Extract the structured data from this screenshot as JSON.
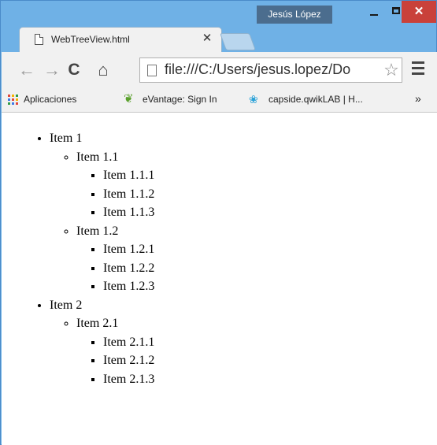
{
  "window": {
    "user_name": "Jesús López",
    "close_glyph": "✕"
  },
  "tab": {
    "title": "WebTreeView.html",
    "close_glyph": "✕"
  },
  "toolbar": {
    "back_glyph": "←",
    "forward_glyph": "→",
    "reload_glyph": "C",
    "home_glyph": "⌂",
    "address": "file:///C:/Users/jesus.lopez/Do",
    "star_glyph": "☆"
  },
  "bookmarks": {
    "apps": "Aplicaciones",
    "evantage": "eVantage: Sign In",
    "capside": "capside.qwikLAB | H...",
    "more": "»"
  },
  "tree": [
    {
      "label": "Item 1",
      "children": [
        {
          "label": "Item 1.1",
          "children": [
            {
              "label": "Item 1.1.1"
            },
            {
              "label": "Item 1.1.2"
            },
            {
              "label": "Item 1.1.3"
            }
          ]
        },
        {
          "label": "Item 1.2",
          "children": [
            {
              "label": "Item 1.2.1"
            },
            {
              "label": "Item 1.2.2"
            },
            {
              "label": "Item 1.2.3"
            }
          ]
        }
      ]
    },
    {
      "label": "Item 2",
      "children": [
        {
          "label": "Item 2.1",
          "children": [
            {
              "label": "Item 2.1.1"
            },
            {
              "label": "Item 2.1.2"
            },
            {
              "label": "Item 2.1.3"
            }
          ]
        }
      ]
    }
  ],
  "colors": {
    "frame": "#6fb1e6",
    "close_button": "#c9413a",
    "user_badge": "#4b6d8e"
  }
}
